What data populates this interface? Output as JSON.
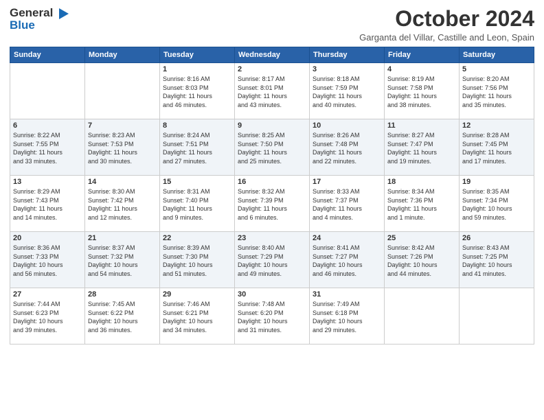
{
  "header": {
    "logo_general": "General",
    "logo_blue": "Blue",
    "title": "October 2024",
    "subtitle": "Garganta del Villar, Castille and Leon, Spain"
  },
  "weekdays": [
    "Sunday",
    "Monday",
    "Tuesday",
    "Wednesday",
    "Thursday",
    "Friday",
    "Saturday"
  ],
  "weeks": [
    [
      {
        "day": "",
        "info": ""
      },
      {
        "day": "",
        "info": ""
      },
      {
        "day": "1",
        "info": "Sunrise: 8:16 AM\nSunset: 8:03 PM\nDaylight: 11 hours\nand 46 minutes."
      },
      {
        "day": "2",
        "info": "Sunrise: 8:17 AM\nSunset: 8:01 PM\nDaylight: 11 hours\nand 43 minutes."
      },
      {
        "day": "3",
        "info": "Sunrise: 8:18 AM\nSunset: 7:59 PM\nDaylight: 11 hours\nand 40 minutes."
      },
      {
        "day": "4",
        "info": "Sunrise: 8:19 AM\nSunset: 7:58 PM\nDaylight: 11 hours\nand 38 minutes."
      },
      {
        "day": "5",
        "info": "Sunrise: 8:20 AM\nSunset: 7:56 PM\nDaylight: 11 hours\nand 35 minutes."
      }
    ],
    [
      {
        "day": "6",
        "info": "Sunrise: 8:22 AM\nSunset: 7:55 PM\nDaylight: 11 hours\nand 33 minutes."
      },
      {
        "day": "7",
        "info": "Sunrise: 8:23 AM\nSunset: 7:53 PM\nDaylight: 11 hours\nand 30 minutes."
      },
      {
        "day": "8",
        "info": "Sunrise: 8:24 AM\nSunset: 7:51 PM\nDaylight: 11 hours\nand 27 minutes."
      },
      {
        "day": "9",
        "info": "Sunrise: 8:25 AM\nSunset: 7:50 PM\nDaylight: 11 hours\nand 25 minutes."
      },
      {
        "day": "10",
        "info": "Sunrise: 8:26 AM\nSunset: 7:48 PM\nDaylight: 11 hours\nand 22 minutes."
      },
      {
        "day": "11",
        "info": "Sunrise: 8:27 AM\nSunset: 7:47 PM\nDaylight: 11 hours\nand 19 minutes."
      },
      {
        "day": "12",
        "info": "Sunrise: 8:28 AM\nSunset: 7:45 PM\nDaylight: 11 hours\nand 17 minutes."
      }
    ],
    [
      {
        "day": "13",
        "info": "Sunrise: 8:29 AM\nSunset: 7:43 PM\nDaylight: 11 hours\nand 14 minutes."
      },
      {
        "day": "14",
        "info": "Sunrise: 8:30 AM\nSunset: 7:42 PM\nDaylight: 11 hours\nand 12 minutes."
      },
      {
        "day": "15",
        "info": "Sunrise: 8:31 AM\nSunset: 7:40 PM\nDaylight: 11 hours\nand 9 minutes."
      },
      {
        "day": "16",
        "info": "Sunrise: 8:32 AM\nSunset: 7:39 PM\nDaylight: 11 hours\nand 6 minutes."
      },
      {
        "day": "17",
        "info": "Sunrise: 8:33 AM\nSunset: 7:37 PM\nDaylight: 11 hours\nand 4 minutes."
      },
      {
        "day": "18",
        "info": "Sunrise: 8:34 AM\nSunset: 7:36 PM\nDaylight: 11 hours\nand 1 minute."
      },
      {
        "day": "19",
        "info": "Sunrise: 8:35 AM\nSunset: 7:34 PM\nDaylight: 10 hours\nand 59 minutes."
      }
    ],
    [
      {
        "day": "20",
        "info": "Sunrise: 8:36 AM\nSunset: 7:33 PM\nDaylight: 10 hours\nand 56 minutes."
      },
      {
        "day": "21",
        "info": "Sunrise: 8:37 AM\nSunset: 7:32 PM\nDaylight: 10 hours\nand 54 minutes."
      },
      {
        "day": "22",
        "info": "Sunrise: 8:39 AM\nSunset: 7:30 PM\nDaylight: 10 hours\nand 51 minutes."
      },
      {
        "day": "23",
        "info": "Sunrise: 8:40 AM\nSunset: 7:29 PM\nDaylight: 10 hours\nand 49 minutes."
      },
      {
        "day": "24",
        "info": "Sunrise: 8:41 AM\nSunset: 7:27 PM\nDaylight: 10 hours\nand 46 minutes."
      },
      {
        "day": "25",
        "info": "Sunrise: 8:42 AM\nSunset: 7:26 PM\nDaylight: 10 hours\nand 44 minutes."
      },
      {
        "day": "26",
        "info": "Sunrise: 8:43 AM\nSunset: 7:25 PM\nDaylight: 10 hours\nand 41 minutes."
      }
    ],
    [
      {
        "day": "27",
        "info": "Sunrise: 7:44 AM\nSunset: 6:23 PM\nDaylight: 10 hours\nand 39 minutes."
      },
      {
        "day": "28",
        "info": "Sunrise: 7:45 AM\nSunset: 6:22 PM\nDaylight: 10 hours\nand 36 minutes."
      },
      {
        "day": "29",
        "info": "Sunrise: 7:46 AM\nSunset: 6:21 PM\nDaylight: 10 hours\nand 34 minutes."
      },
      {
        "day": "30",
        "info": "Sunrise: 7:48 AM\nSunset: 6:20 PM\nDaylight: 10 hours\nand 31 minutes."
      },
      {
        "day": "31",
        "info": "Sunrise: 7:49 AM\nSunset: 6:18 PM\nDaylight: 10 hours\nand 29 minutes."
      },
      {
        "day": "",
        "info": ""
      },
      {
        "day": "",
        "info": ""
      }
    ]
  ]
}
